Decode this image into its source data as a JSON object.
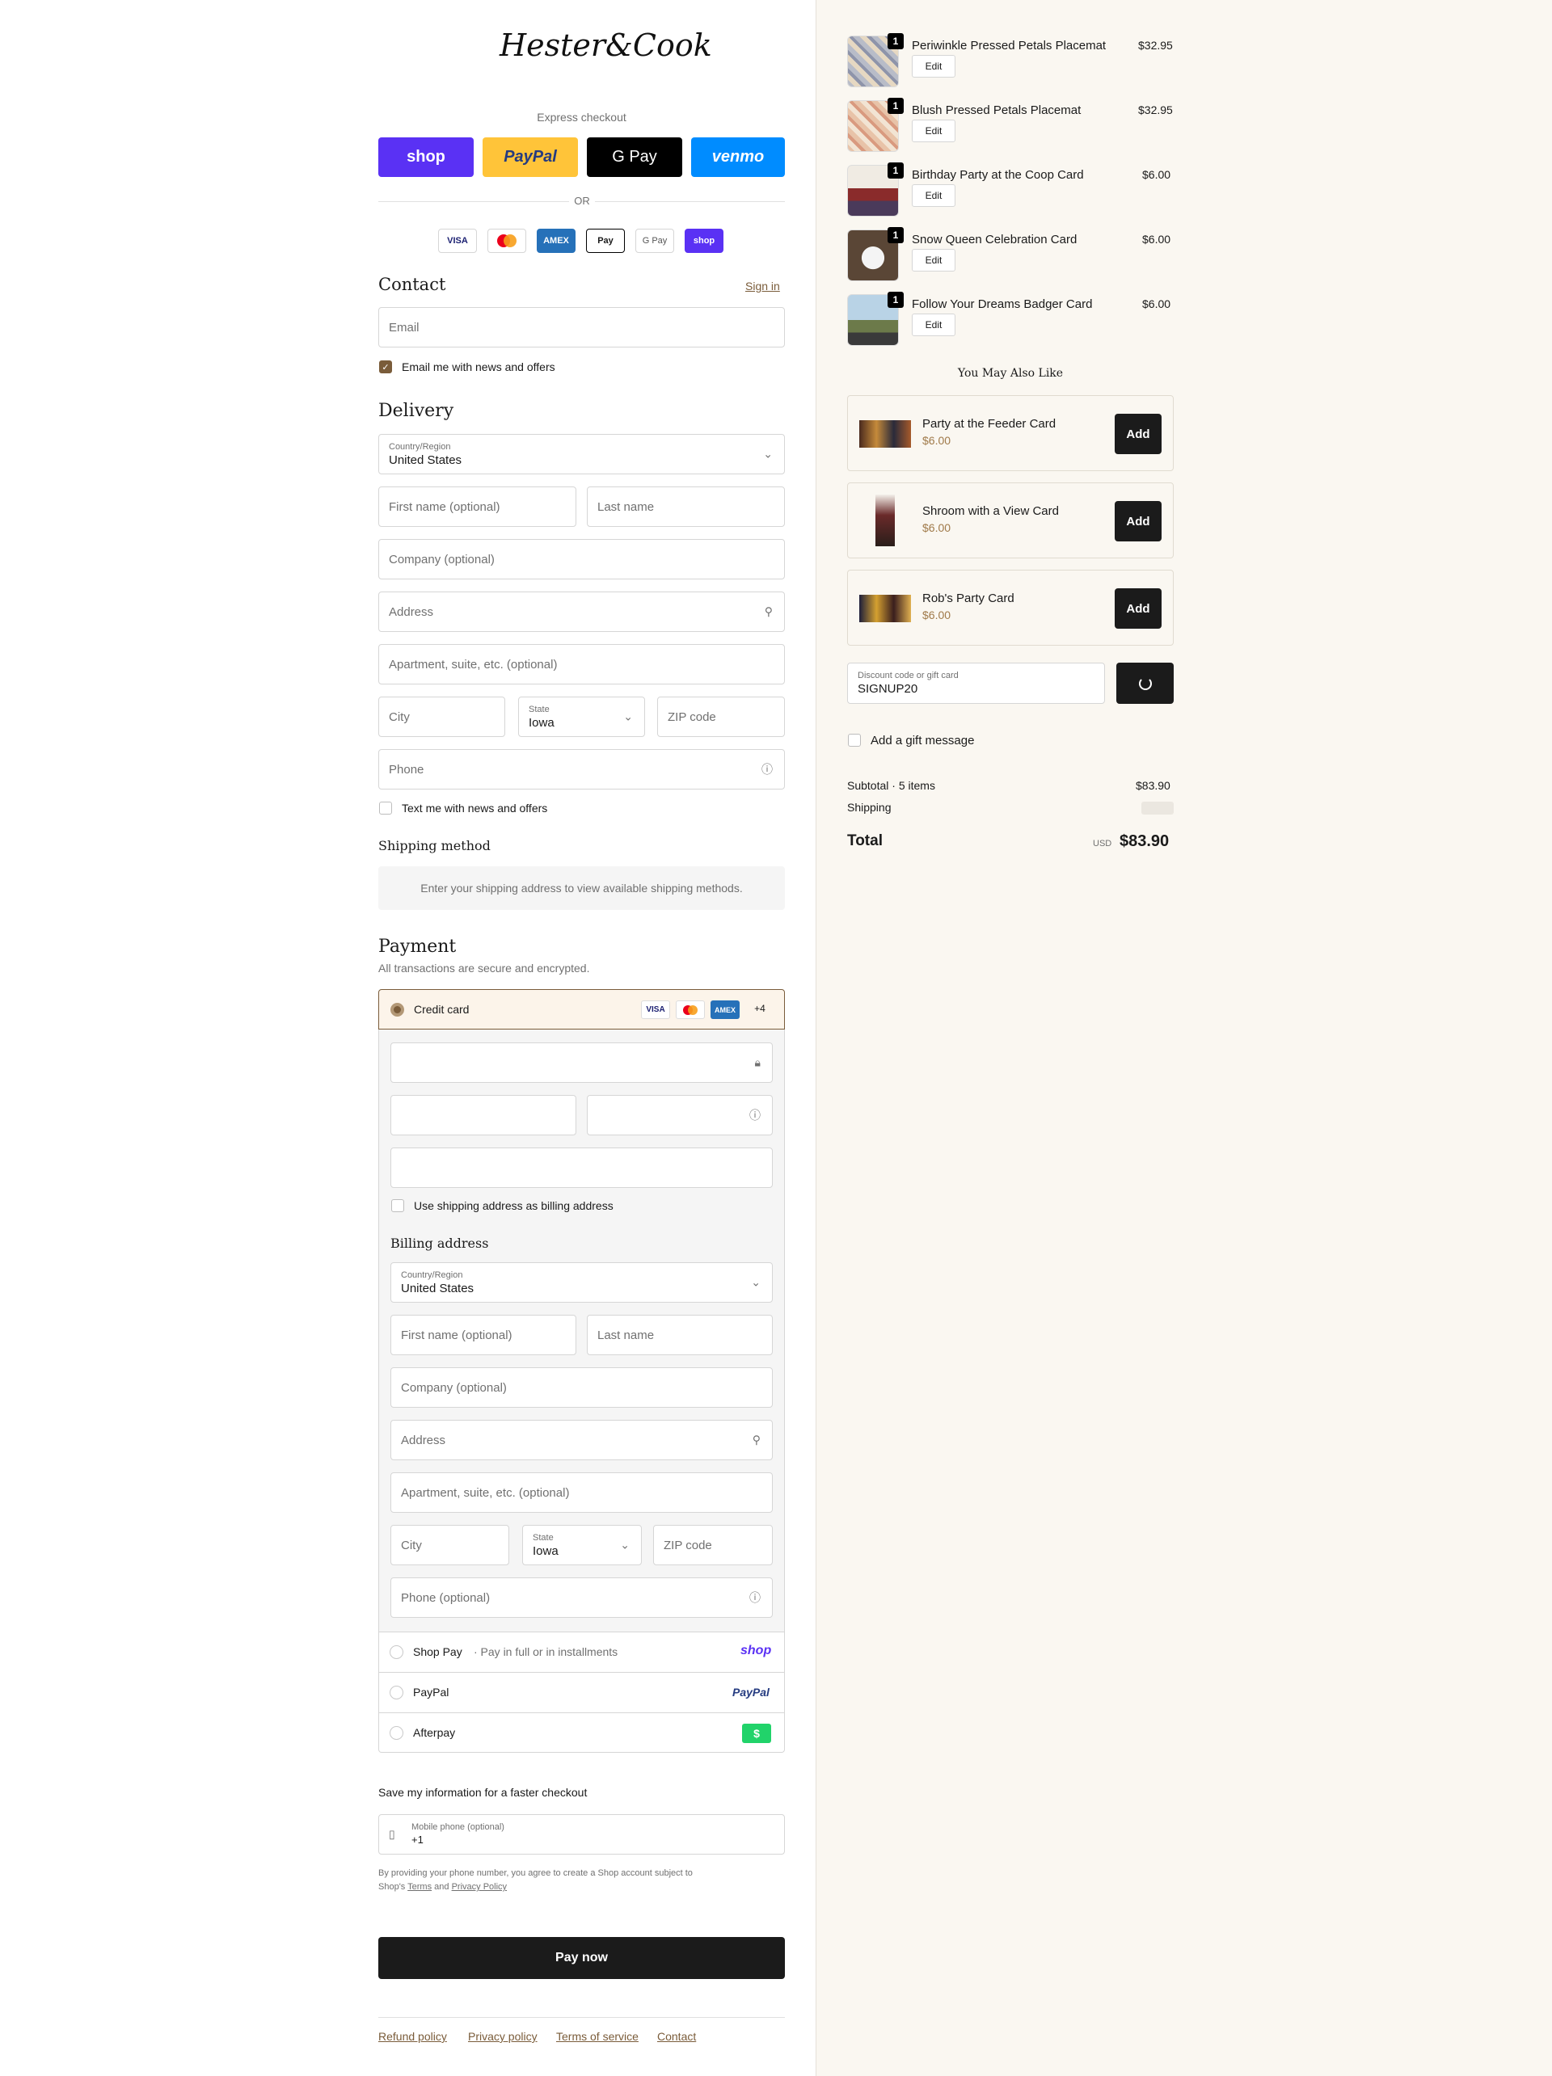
{
  "brand": {
    "logo_text": "Hester&Cook"
  },
  "express": {
    "title": "Express checkout",
    "buttons": [
      "shop",
      "PayPal",
      "G Pay",
      "venmo"
    ],
    "or": "OR",
    "accepted": [
      "VISA",
      "MC",
      "AMEX",
      "Pay",
      "G Pay",
      "shop"
    ]
  },
  "contact": {
    "title": "Contact",
    "sign_in": "Sign in",
    "email_placeholder": "Email",
    "news_label": "Email me with news and offers"
  },
  "delivery": {
    "title": "Delivery",
    "country_label": "Country/Region",
    "country_value": "United States",
    "first_name": "First name (optional)",
    "last_name": "Last name",
    "company": "Company (optional)",
    "address": "Address",
    "apartment": "Apartment, suite, etc. (optional)",
    "city": "City",
    "state_label": "State",
    "state_value": "Iowa",
    "zip": "ZIP code",
    "phone": "Phone",
    "text_label": "Text me with news and offers"
  },
  "shipping": {
    "title": "Shipping method",
    "notice": "Enter your shipping address to view available shipping methods."
  },
  "payment": {
    "title": "Payment",
    "subtitle": "All transactions are secure and encrypted.",
    "credit_card": "Credit card",
    "more_cards": "+4",
    "card_logos": [
      "VISA",
      "MC",
      "AMEX"
    ],
    "billing_same": "Use shipping address as billing address",
    "billing_title": "Billing address",
    "billing_phone": "Phone (optional)",
    "shop_pay": "Shop Pay",
    "shop_pay_note": "· Pay in full or in installments",
    "shop_pay_logo": "shop",
    "paypal": "PayPal",
    "paypal_logo": "PayPal",
    "afterpay": "Afterpay",
    "afterpay_logo": "$"
  },
  "save_info": {
    "title": "Save my information for a faster checkout",
    "mobile_label": "Mobile phone (optional)",
    "mobile_value": "+1",
    "disclaimer_1": "By providing your phone number, you agree to create a Shop account subject to",
    "disclaimer_2": "Shop's",
    "terms": "Terms",
    "and": "and",
    "privacy": "Privacy Policy"
  },
  "pay_now": "Pay now",
  "footer_links": [
    "Refund policy",
    "Privacy policy",
    "Terms of service",
    "Contact"
  ],
  "cart": {
    "items": [
      {
        "name": "Periwinkle Pressed Petals Placemat",
        "price": "$32.95",
        "qty": "1",
        "edit": "Edit"
      },
      {
        "name": "Blush Pressed Petals Placemat",
        "price": "$32.95",
        "qty": "1",
        "edit": "Edit"
      },
      {
        "name": "Birthday Party at the Coop Card",
        "price": "$6.00",
        "qty": "1",
        "edit": "Edit"
      },
      {
        "name": "Snow Queen Celebration Card",
        "price": "$6.00",
        "qty": "1",
        "edit": "Edit"
      },
      {
        "name": "Follow Your Dreams Badger Card",
        "price": "$6.00",
        "qty": "1",
        "edit": "Edit"
      }
    ],
    "upsell_title": "You May Also Like",
    "upsell": [
      {
        "name": "Party at the Feeder Card",
        "price": "$6.00",
        "add": "Add"
      },
      {
        "name": "Shroom with a View Card",
        "price": "$6.00",
        "add": "Add"
      },
      {
        "name": "Rob's Party Card",
        "price": "$6.00",
        "add": "Add"
      }
    ],
    "discount_label": "Discount code or gift card",
    "discount_value": "SIGNUP20",
    "gift_label": "Add a gift message",
    "subtotal_label": "Subtotal · 5 items",
    "subtotal_value": "$83.90",
    "shipping_label": "Shipping",
    "total_label": "Total",
    "currency": "USD",
    "total_value": "$83.90"
  },
  "colors": {
    "accent": "#7a5c3a",
    "sidebar_bg": "#faf7f1",
    "dark": "#1b1b1b"
  }
}
